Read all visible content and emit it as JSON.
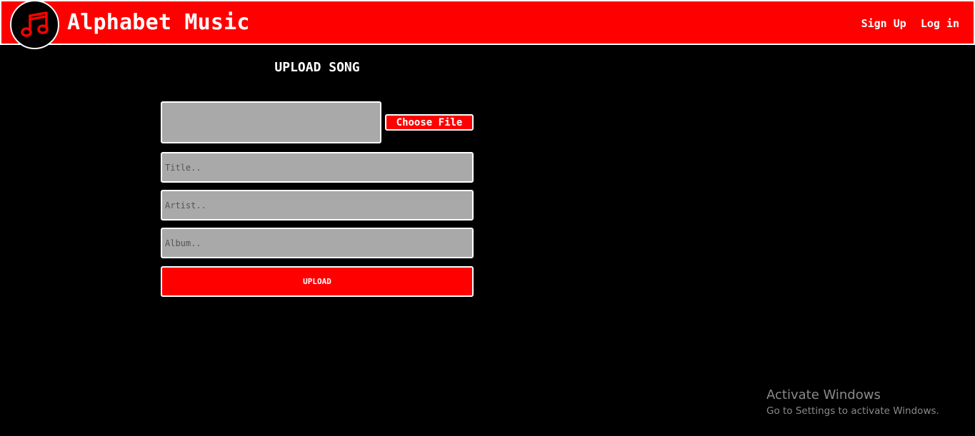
{
  "app": {
    "brand": "Alphabet Music",
    "logo_icon": "music-note-icon",
    "accent_color": "#ff0000"
  },
  "nav": {
    "links": [
      {
        "label": "Sign Up"
      },
      {
        "label": "Log in"
      }
    ]
  },
  "form": {
    "title": "UPLOAD SONG",
    "choose_file_label": "Choose File",
    "title_placeholder": "Title..",
    "artist_placeholder": "Artist..",
    "album_placeholder": "Album..",
    "submit_label": "UPLOAD"
  },
  "watermark": {
    "title": "Activate Windows",
    "subtitle": "Go to Settings to activate Windows."
  }
}
